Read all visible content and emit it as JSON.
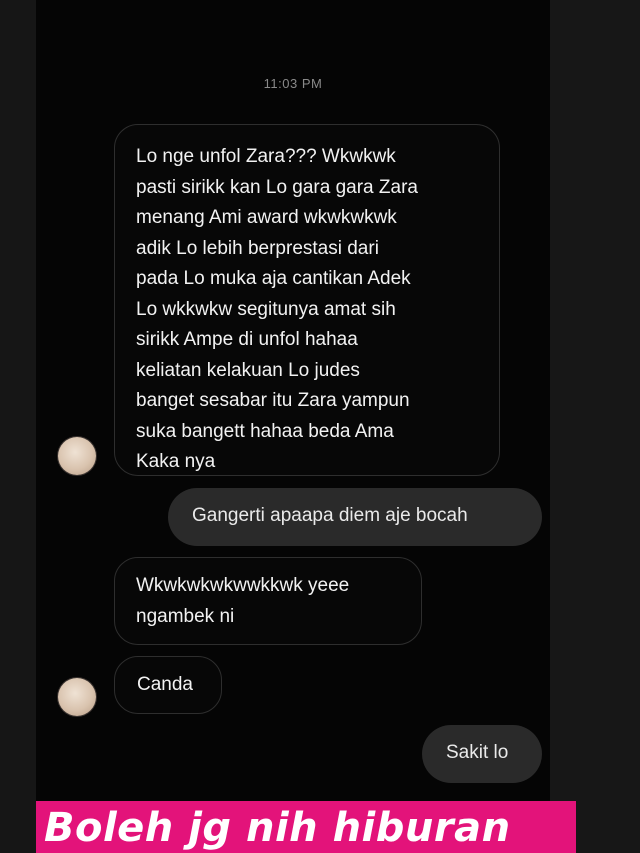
{
  "chat": {
    "timestamp": "11:03 PM",
    "messages": [
      {
        "direction": "incoming",
        "text": "Lo nge unfol Zara??? Wkwkwk\npasti sirikk kan Lo gara gara Zara\nmenang Ami award wkwkwkwk\nadik Lo lebih berprestasi dari\npada Lo muka aja cantikan Adek\nLo wkkwkw segitunya amat sih\nsirikk Ampe di unfol hahaa\nkeliatan kelakuan Lo judes\nbanget sesabar itu Zara yampun\nsuka bangett hahaa beda Ama\nKaka nya"
      },
      {
        "direction": "outgoing",
        "text": "Gangerti apaapa diem aje bocah"
      },
      {
        "direction": "incoming",
        "text": "Wkwkwkwkwwkkwk yeee\nngambek ni"
      },
      {
        "direction": "incoming",
        "text": "Canda"
      },
      {
        "direction": "outgoing",
        "text": "Sakit lo"
      }
    ]
  },
  "caption": {
    "text": "Boleh jg nih hiburan",
    "background": "#e3137a"
  },
  "icons": {
    "avatar": "contact-avatar"
  }
}
